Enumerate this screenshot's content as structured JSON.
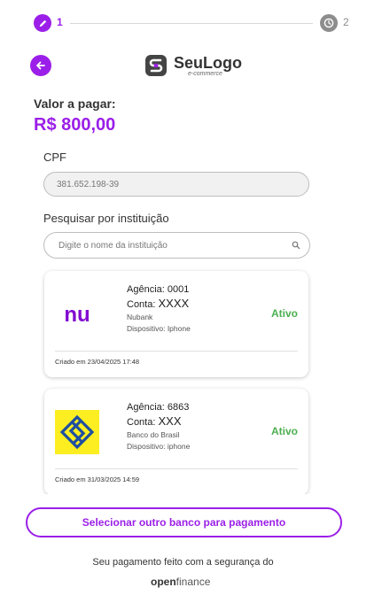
{
  "stepper": {
    "step1_number": "1",
    "step2_number": "2",
    "active_color": "#9b1fe8",
    "inactive_color": "#8d8d8d"
  },
  "header": {
    "logo_name": "SeuLogo",
    "logo_sub": "e-commerce"
  },
  "payment": {
    "amount_label": "Valor a pagar:",
    "amount_value": "R$ 800,00"
  },
  "cpf": {
    "label": "CPF",
    "value": "381.652.198-39"
  },
  "search": {
    "label": "Pesquisar por instituição",
    "placeholder": "Digite o nome da instituição"
  },
  "accounts": [
    {
      "agencia": "Agência: 0001",
      "conta_label": "Conta:",
      "conta_value": "XXXX",
      "bank": "Nubank",
      "device": "Dispositivo: Iphone",
      "status": "Ativo",
      "created": "Criado em 23/04/2025 17:48",
      "logo_text": "nu",
      "brand_color": "#820ad1"
    },
    {
      "agencia": "Agência: 6863",
      "conta_label": "Conta:",
      "conta_value": "XXX",
      "bank": "Banco do Brasil",
      "device": "Dispositivo: iphone",
      "status": "Ativo",
      "created": "Criado em 31/03/2025 14:59",
      "brand_color": "#fcee21"
    }
  ],
  "actions": {
    "select_other_bank": "Selecionar outro banco para pagamento"
  },
  "footer": {
    "text": "Seu pagamento feito com a segurança do",
    "brand_open": "open",
    "brand_finance": "finance"
  },
  "icons": {
    "step1": "pencil-icon",
    "step2": "clock-icon",
    "back": "arrow-left-icon",
    "search": "search-icon"
  }
}
